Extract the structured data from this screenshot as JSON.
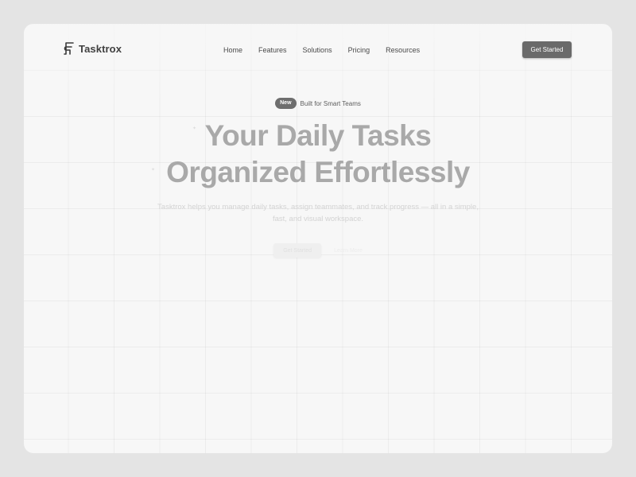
{
  "brand": {
    "name": "Tasktrox",
    "icon": "tasktrox-logo-icon"
  },
  "nav": {
    "items": [
      {
        "label": "Home"
      },
      {
        "label": "Features"
      },
      {
        "label": "Solutions"
      },
      {
        "label": "Pricing"
      },
      {
        "label": "Resources"
      }
    ],
    "cta_label": "Get Started"
  },
  "hero": {
    "badge": "New",
    "badge_text": "Built for Smart Teams",
    "headline_line1": "Your Daily Tasks",
    "headline_line2": "Organized Effortlessly",
    "subtitle": "Tasktrox helps you manage daily tasks, assign teammates, and track progress — all in a simple, fast, and visual workspace.",
    "primary_button": "Get Started",
    "secondary_button": "Learn More"
  },
  "colors": {
    "page_background": "#e4e4e4",
    "card_background": "#f7f7f7",
    "cta_background": "#6a6a6a",
    "headline": "#a9a9a9"
  }
}
